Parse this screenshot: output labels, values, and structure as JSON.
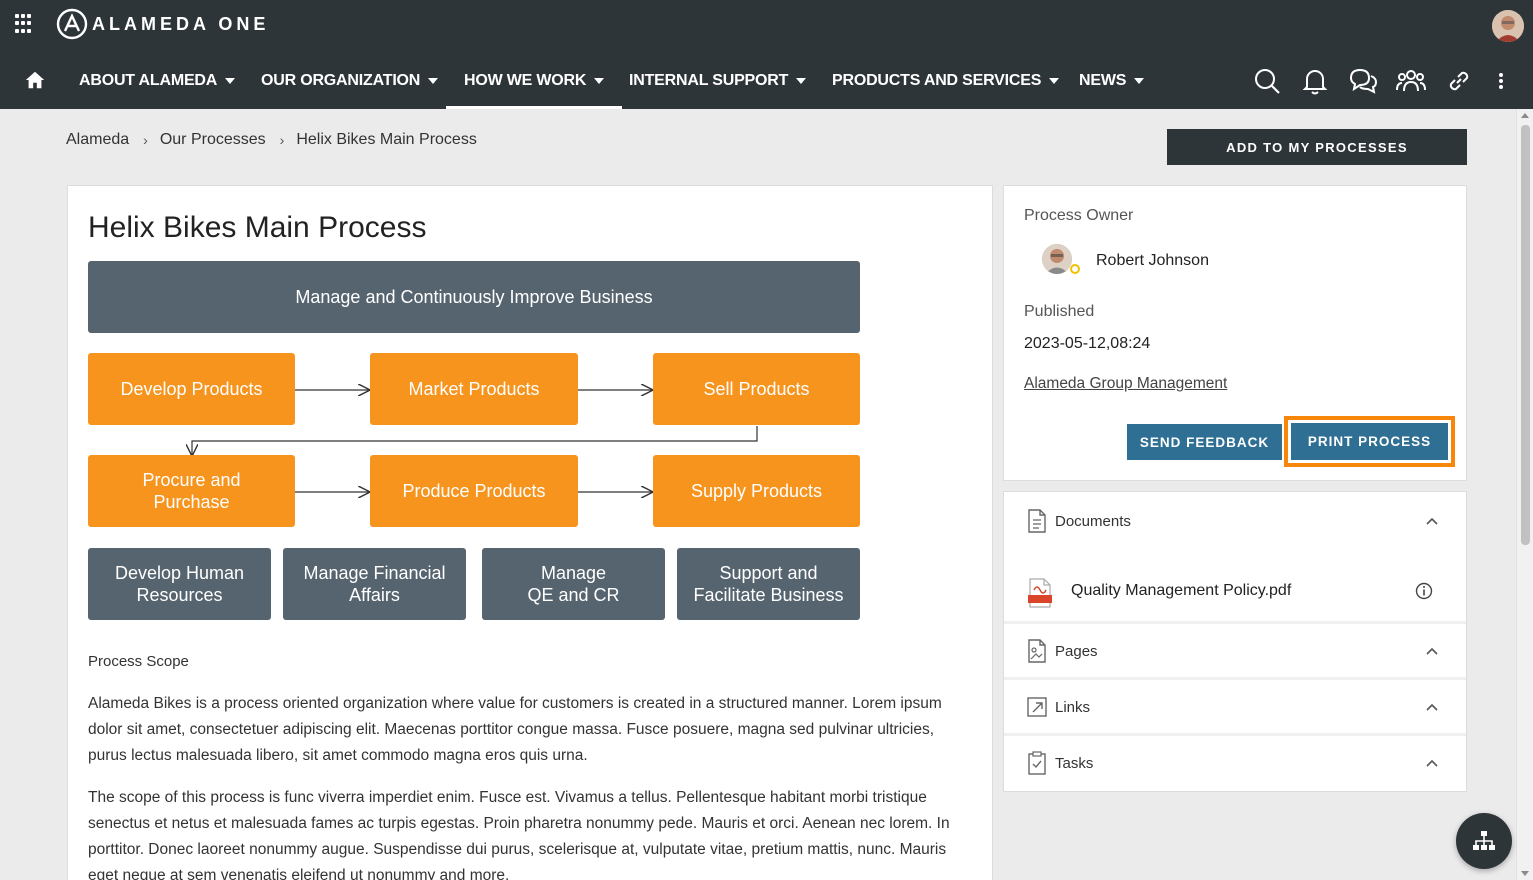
{
  "app": {
    "name": "ALAMEDA ONE"
  },
  "nav": {
    "items": [
      {
        "label": "ABOUT ALAMEDA"
      },
      {
        "label": "OUR ORGANIZATION"
      },
      {
        "label": "HOW WE WORK",
        "active": true
      },
      {
        "label": "INTERNAL SUPPORT"
      },
      {
        "label": "PRODUCTS AND SERVICES"
      },
      {
        "label": "NEWS"
      }
    ],
    "icons": [
      "search-icon",
      "bell-icon",
      "chat-icon",
      "people-icon",
      "link-icon",
      "more-vertical-icon"
    ]
  },
  "breadcrumb": [
    "Alameda",
    "Our Processes",
    "Helix Bikes Main Process"
  ],
  "actions": {
    "add_to_my_processes": "ADD TO MY PROCESSES"
  },
  "process": {
    "title": "Helix Bikes Main Process",
    "diagram": {
      "top": "Manage and Continuously Improve Business",
      "row1": [
        "Develop Products",
        "Market Products",
        "Sell Products"
      ],
      "row2": [
        "Procure and\nPurchase",
        "Produce Products",
        "Supply Products"
      ],
      "row3": [
        "Develop Human\nResources",
        "Manage Financial\nAffairs",
        "Manage\nQE and CR",
        "Support and\nFacilitate Business"
      ]
    },
    "scope_title": "Process Scope",
    "paragraphs": [
      "Alameda Bikes is a process oriented organization where value for customers is created in a structured manner. Lorem ipsum dolor sit amet, consectetuer adipiscing elit. Maecenas porttitor congue massa. Fusce posuere, magna sed pulvinar ultricies, purus lectus malesuada libero, sit amet commodo magna eros quis urna.",
      "The scope of this process is func viverra imperdiet enim. Fusce est. Vivamus a tellus. Pellentesque habitant morbi tristique senectus et netus et malesuada fames ac turpis egestas. Proin pharetra nonummy pede. Mauris et orci. Aenean nec lorem. In porttitor. Donec laoreet nonummy augue. Suspendisse dui purus, scelerisque at, vulputate vitae, pretium mattis, nunc. Mauris eget neque at sem venenatis eleifend ut nonummy and more."
    ]
  },
  "sidebar": {
    "owner_label": "Process Owner",
    "owner_name": "Robert Johnson",
    "published_label": "Published",
    "published_date": "2023-05-12,08:24",
    "group_link": "Alameda Group Management",
    "send_feedback": "SEND FEEDBACK",
    "print_process": "PRINT PROCESS",
    "accordion": {
      "documents": "Documents",
      "document_item": "Quality Management Policy.pdf",
      "pages": "Pages",
      "links": "Links",
      "tasks": "Tasks"
    }
  },
  "colors": {
    "topbar": "#2e3539",
    "orange": "#f7941d",
    "slate": "#56646f",
    "button_blue": "#2f6f94",
    "highlight": "#f7860b"
  }
}
